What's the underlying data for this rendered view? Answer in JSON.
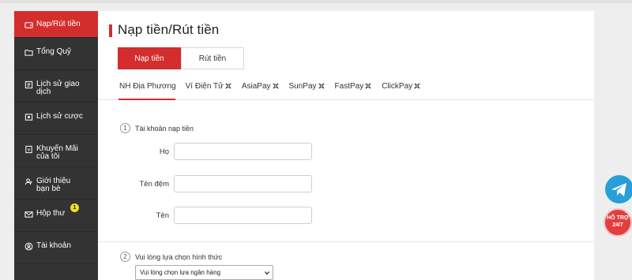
{
  "sidebar": {
    "items": [
      {
        "label": "Nạp/Rút tiền",
        "icon": "wallet-icon"
      },
      {
        "label": "Tổng Quỹ",
        "icon": "folder-icon"
      },
      {
        "label": "Lịch sử giao dịch",
        "icon": "history-icon"
      },
      {
        "label": "Lịch sử cược",
        "icon": "bet-history-icon"
      },
      {
        "label": "Khuyến Mãi của tôi",
        "icon": "promo-icon"
      },
      {
        "label": "Giới thiệu bạn bè",
        "icon": "refer-icon"
      },
      {
        "label": "Hộp thư",
        "icon": "mail-icon",
        "badge": "1"
      },
      {
        "label": "Tài khoản",
        "icon": "account-icon"
      }
    ]
  },
  "main": {
    "title": "Nạp tiền/Rút tiền",
    "tabs": [
      {
        "label": "Nạp tiền"
      },
      {
        "label": "Rút tiền"
      }
    ],
    "method_tabs": [
      {
        "label": "NH Địa Phương"
      },
      {
        "label": "Ví Điện Tử"
      },
      {
        "label": "AsiaPay"
      },
      {
        "label": "SunPay"
      },
      {
        "label": "FastPay"
      },
      {
        "label": "ClickPay"
      }
    ],
    "step1": {
      "num": "1",
      "label": "Tài khoản nạp tiền"
    },
    "fields": {
      "ho": {
        "label": "Họ"
      },
      "ten_dem": {
        "label": "Tên đệm"
      },
      "ten": {
        "label": "Tên"
      }
    },
    "step2": {
      "num": "2",
      "label": "Vui lòng lựa chọn hình thức"
    },
    "bank_select": {
      "value": "Vui lòng chọn lựa ngân hàng"
    }
  },
  "support": {
    "line1": "HỖ TRỢ",
    "line2": "24/7"
  },
  "colors": {
    "accent": "#d32d2d",
    "sidebar": "#333333",
    "telegram": "#279fd8"
  }
}
